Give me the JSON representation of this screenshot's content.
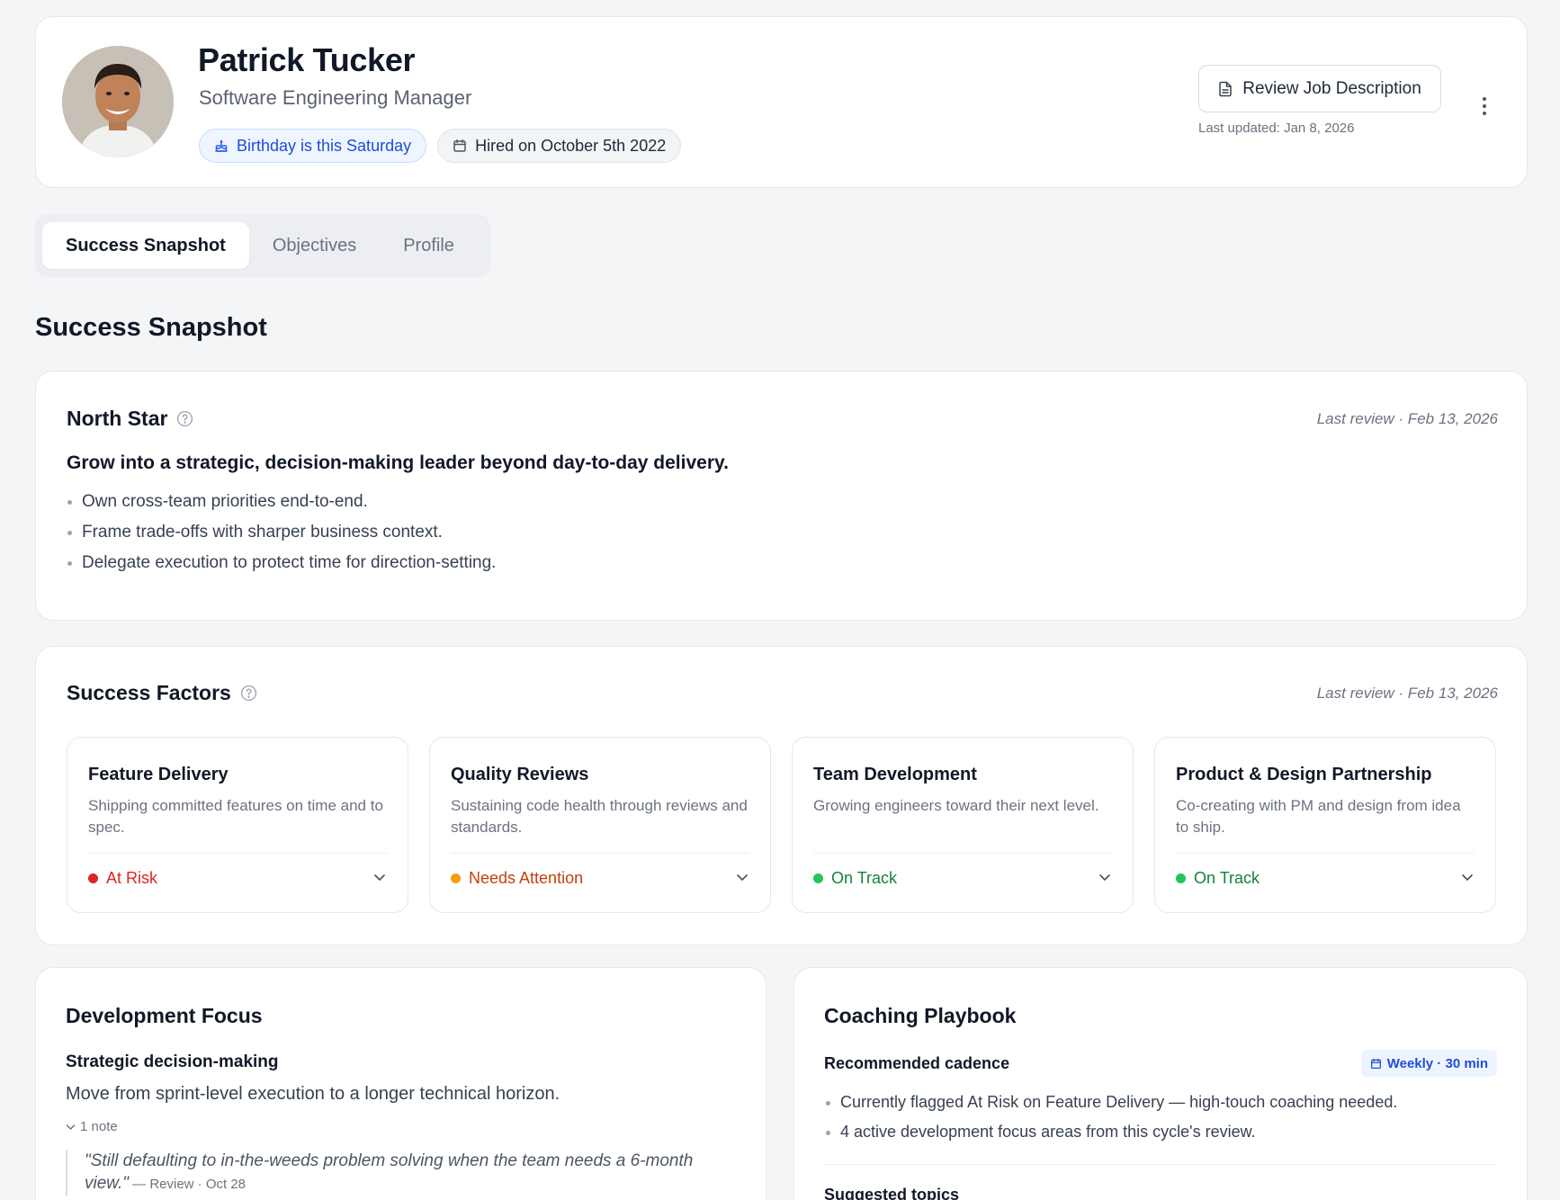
{
  "header": {
    "name": "Patrick Tucker",
    "role": "Software Engineering Manager",
    "birthday_chip": "Birthday is this Saturday",
    "hired_chip": "Hired on October 5th 2022",
    "review_button": "Review Job Description",
    "last_updated": "Last updated: Jan 8, 2026"
  },
  "tabs": [
    {
      "label": "Success Snapshot",
      "active": true
    },
    {
      "label": "Objectives",
      "active": false
    },
    {
      "label": "Profile",
      "active": false
    }
  ],
  "section_title": "Success Snapshot",
  "north_star": {
    "title": "North Star",
    "last_review": "Last review · Feb 13, 2026",
    "goal": "Grow into a strategic, decision-making leader beyond day-to-day delivery.",
    "bullets": [
      "Own cross-team priorities end-to-end.",
      "Frame trade-offs with sharper business context.",
      "Delegate execution to protect time for direction-setting."
    ]
  },
  "success_factors": {
    "title": "Success Factors",
    "last_review": "Last review · Feb 13, 2026",
    "items": [
      {
        "title": "Feature Delivery",
        "description": "Shipping committed features on time and to spec.",
        "status": "At Risk",
        "status_color": "#dc2626",
        "dot_color": "#dc2626"
      },
      {
        "title": "Quality Reviews",
        "description": "Sustaining code health through reviews and standards.",
        "status": "Needs Attention",
        "status_color": "#c2410c",
        "dot_color": "#f59e0b"
      },
      {
        "title": "Team Development",
        "description": "Growing engineers toward their next level.",
        "status": "On Track",
        "status_color": "#15803d",
        "dot_color": "#22c55e"
      },
      {
        "title": "Product & Design Partnership",
        "description": "Co-creating with PM and design from idea to ship.",
        "status": "On Track",
        "status_color": "#15803d",
        "dot_color": "#22c55e"
      }
    ]
  },
  "development_focus": {
    "title": "Development Focus",
    "subtitle": "Strategic decision-making",
    "description": "Move from sprint-level execution to a longer technical horizon.",
    "note_toggle": "1 note",
    "quote": "\"Still defaulting to in-the-weeds problem solving when the team needs a 6-month view.\"",
    "quote_source": " — Review · Oct 28"
  },
  "coaching_playbook": {
    "title": "Coaching Playbook",
    "recommended_label": "Recommended cadence",
    "cadence_badge": "Weekly · 30 min",
    "bullets": [
      "Currently flagged At Risk on Feature Delivery — high-touch coaching needed.",
      "4 active development focus areas from this cycle's review."
    ],
    "suggested_topics_label": "Suggested topics"
  },
  "icons": [
    "cake-icon",
    "calendar-icon",
    "document-icon",
    "more-vertical-icon",
    "help-circle-icon",
    "chevron-down-icon"
  ],
  "colors": {
    "accent_blue": "#1d4ed8",
    "background": "#f4f5f7",
    "card": "#ffffff"
  }
}
